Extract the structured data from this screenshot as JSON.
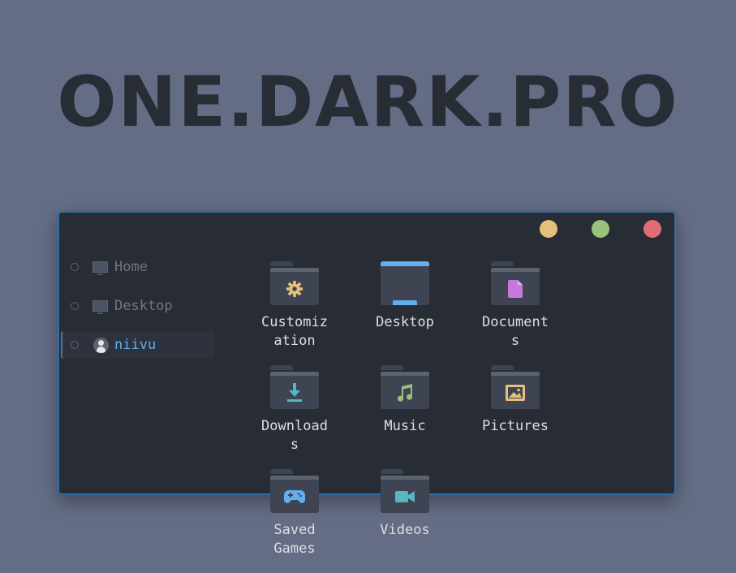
{
  "banner": {
    "text": "ONE.DARK.PRO"
  },
  "window": {
    "controls": [
      {
        "name": "minimize",
        "color": "#e5c07b"
      },
      {
        "name": "maximize",
        "color": "#98c379"
      },
      {
        "name": "close",
        "color": "#e06c75"
      }
    ]
  },
  "sidebar": {
    "items": [
      {
        "label": "Home",
        "icon": "monitor-icon",
        "active": false
      },
      {
        "label": "Desktop",
        "icon": "monitor-icon",
        "active": false
      },
      {
        "label": "niivu",
        "icon": "user-icon",
        "active": true
      }
    ]
  },
  "files": [
    {
      "label": "Customiz\nation",
      "icon": "gear-icon",
      "color": "#e5c07b"
    },
    {
      "label": "Desktop",
      "icon": "desktop-folder-icon",
      "color": "#61afef"
    },
    {
      "label": "Document\ns",
      "icon": "document-icon",
      "color": "#c678dd"
    },
    {
      "label": "Download\ns",
      "icon": "download-icon",
      "color": "#56b6c2"
    },
    {
      "label": "Music",
      "icon": "music-note-icon",
      "color": "#98c379"
    },
    {
      "label": "Pictures",
      "icon": "picture-icon",
      "color": "#e5c07b"
    },
    {
      "label": "Saved\nGames",
      "icon": "gamepad-icon",
      "color": "#61afef"
    },
    {
      "label": "Videos",
      "icon": "video-camera-icon",
      "color": "#56b6c2"
    }
  ],
  "colors": {
    "background": "#646d85",
    "window": "#282c34",
    "accent": "#61afef",
    "border": "#2f6fa6"
  }
}
